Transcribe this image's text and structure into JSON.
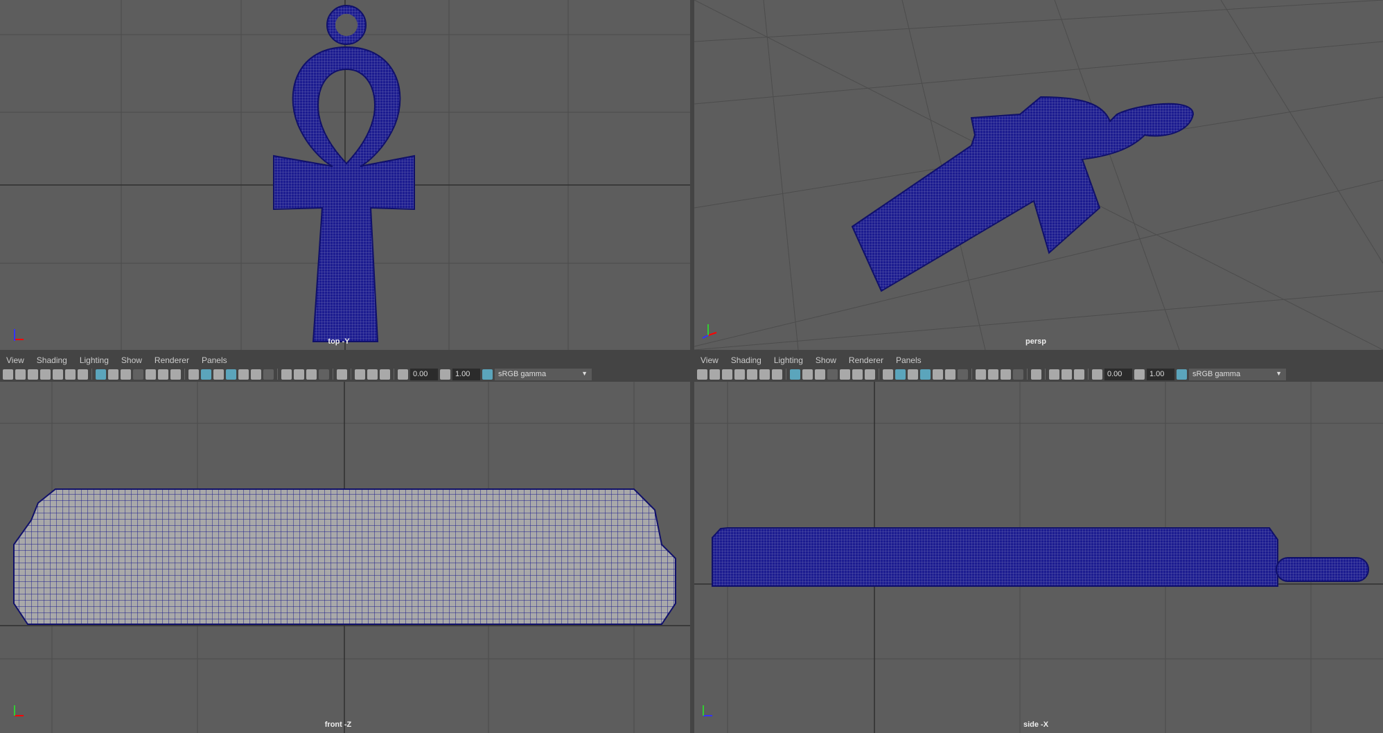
{
  "viewports": [
    {
      "id": "top",
      "label": "top -Y"
    },
    {
      "id": "persp",
      "label": "persp"
    },
    {
      "id": "front",
      "label": "front -Z"
    },
    {
      "id": "side",
      "label": "side -X"
    }
  ],
  "panel_menu": [
    "View",
    "Shading",
    "Lighting",
    "Show",
    "Renderer",
    "Panels"
  ],
  "toolbar": {
    "exposure": "0.00",
    "gamma_value": "1.00",
    "color_space": "sRGB gamma",
    "icons": [
      "camera-icon",
      "lock-camera-icon",
      "camera-attributes-icon",
      "bookmark-icon",
      "image-plane-icon",
      "pan-zoom-icon",
      "grease-pencil-icon",
      "|",
      "grid-icon",
      "film-gate-icon",
      "resolution-gate-icon",
      "gate-mask-icon",
      "field-chart-icon",
      "safe-action-icon",
      "safe-title-icon",
      "|",
      "wireframe-icon",
      "smooth-shade-icon",
      "default-material-icon",
      "wireframe-on-shaded-icon",
      "textured-icon",
      "lights-icon",
      "shadows-icon",
      "|",
      "screen-space-ao-icon",
      "motion-blur-icon",
      "anti-aliasing-icon",
      "depth-of-field-icon",
      "|",
      "isolate-select-icon",
      "|",
      "xray-icon",
      "xray-joints-icon",
      "backface-culling-icon",
      "|",
      "exposure-icon"
    ]
  },
  "colors": {
    "viewport_bg": "#5d5d5d",
    "mesh": "#1a1a8c",
    "active_icon": "#5fb6d1"
  }
}
